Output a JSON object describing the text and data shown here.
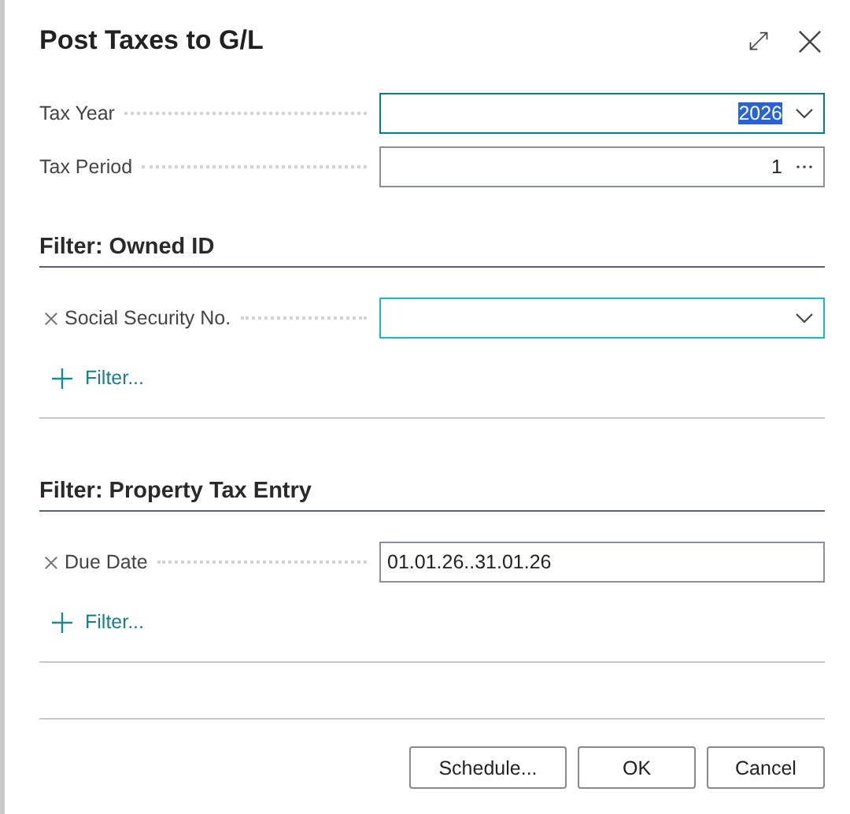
{
  "dialog": {
    "title": "Post Taxes to G/L"
  },
  "fields": [
    {
      "label": "Tax Year",
      "kind": "dropdown",
      "value": "2026",
      "value_selected": true,
      "focused": true,
      "hovered": false
    },
    {
      "label": "Tax Period",
      "kind": "lookup",
      "value": "1",
      "value_selected": false,
      "focused": false,
      "hovered": false
    }
  ],
  "filter_sections": [
    {
      "title": "Filter: Owned ID",
      "filters": [
        {
          "label": "Social Security No.",
          "kind": "dropdown",
          "hovered": true
        }
      ],
      "add_filter": "Filter..."
    },
    {
      "title": "Filter: Property Tax Entry",
      "filters": [
        {
          "label": "Due Date",
          "kind": "text",
          "value": "01.01.26..31.01.26",
          "hovered": false
        }
      ],
      "add_filter": "Filter..."
    }
  ],
  "buttons": [
    "Schedule...",
    "OK",
    "Cancel"
  ]
}
